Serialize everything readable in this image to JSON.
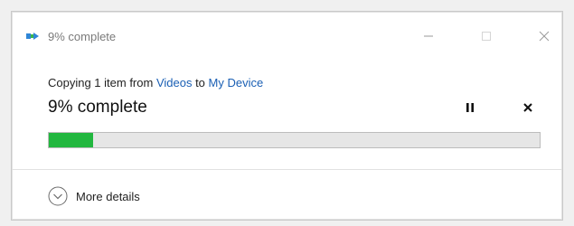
{
  "window": {
    "title": "9% complete",
    "controls": {
      "minimize": "minimize-icon",
      "maximize": "maximize-icon",
      "close": "close-icon"
    }
  },
  "operation": {
    "prefix": "Copying 1 item from ",
    "source": "Videos",
    "connector": " to ",
    "destination": "My Device",
    "status": "9% complete",
    "progress_fraction": 0.09
  },
  "controls": {
    "pause_icon": "pause-icon",
    "cancel_icon": "cancel-icon"
  },
  "footer": {
    "details_label": "More details",
    "details_icon": "chevron-down-circle-icon"
  },
  "colors": {
    "progress_fill": "#22b73f",
    "link": "#1a5fb4",
    "title_text": "#7a7a7a"
  }
}
